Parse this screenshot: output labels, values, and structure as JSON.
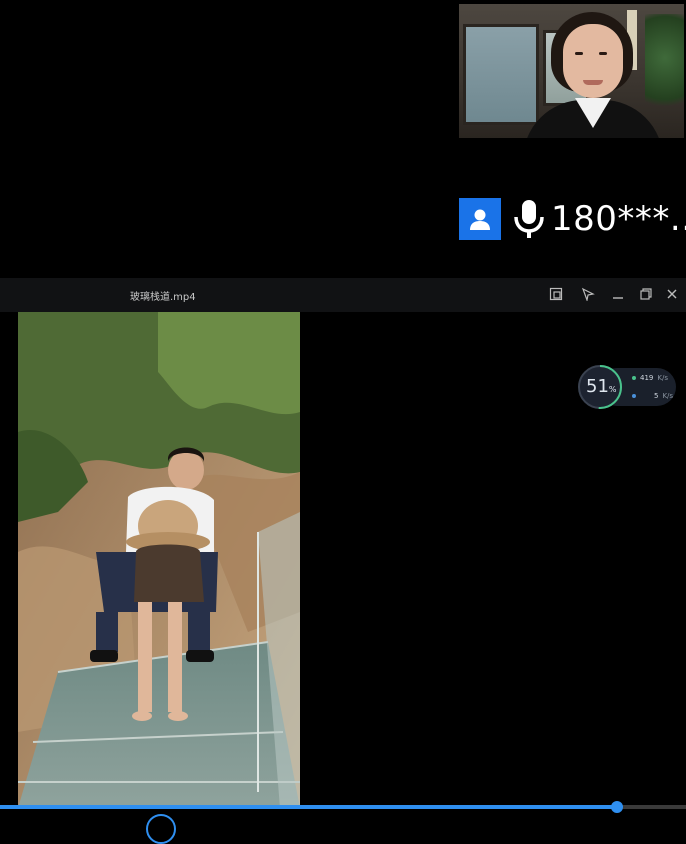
{
  "call": {
    "participant_name": "180***...",
    "icons": {
      "avatar": "person-icon",
      "microphone": "microphone-icon"
    },
    "accent_color": "#1a73e8"
  },
  "player": {
    "file_title": "玻璃栈道.mp4",
    "window_buttons": [
      "screenshot-icon",
      "pin-icon",
      "minimize-icon",
      "restore-icon",
      "close-icon"
    ],
    "progress_fraction": 0.9,
    "progress_color": "#2f8ff0",
    "network_widget": {
      "percent": "51",
      "percent_symbol": "%",
      "download_value": "419",
      "download_unit": "K/s",
      "upload_value": "5",
      "upload_unit": "K/s"
    }
  }
}
